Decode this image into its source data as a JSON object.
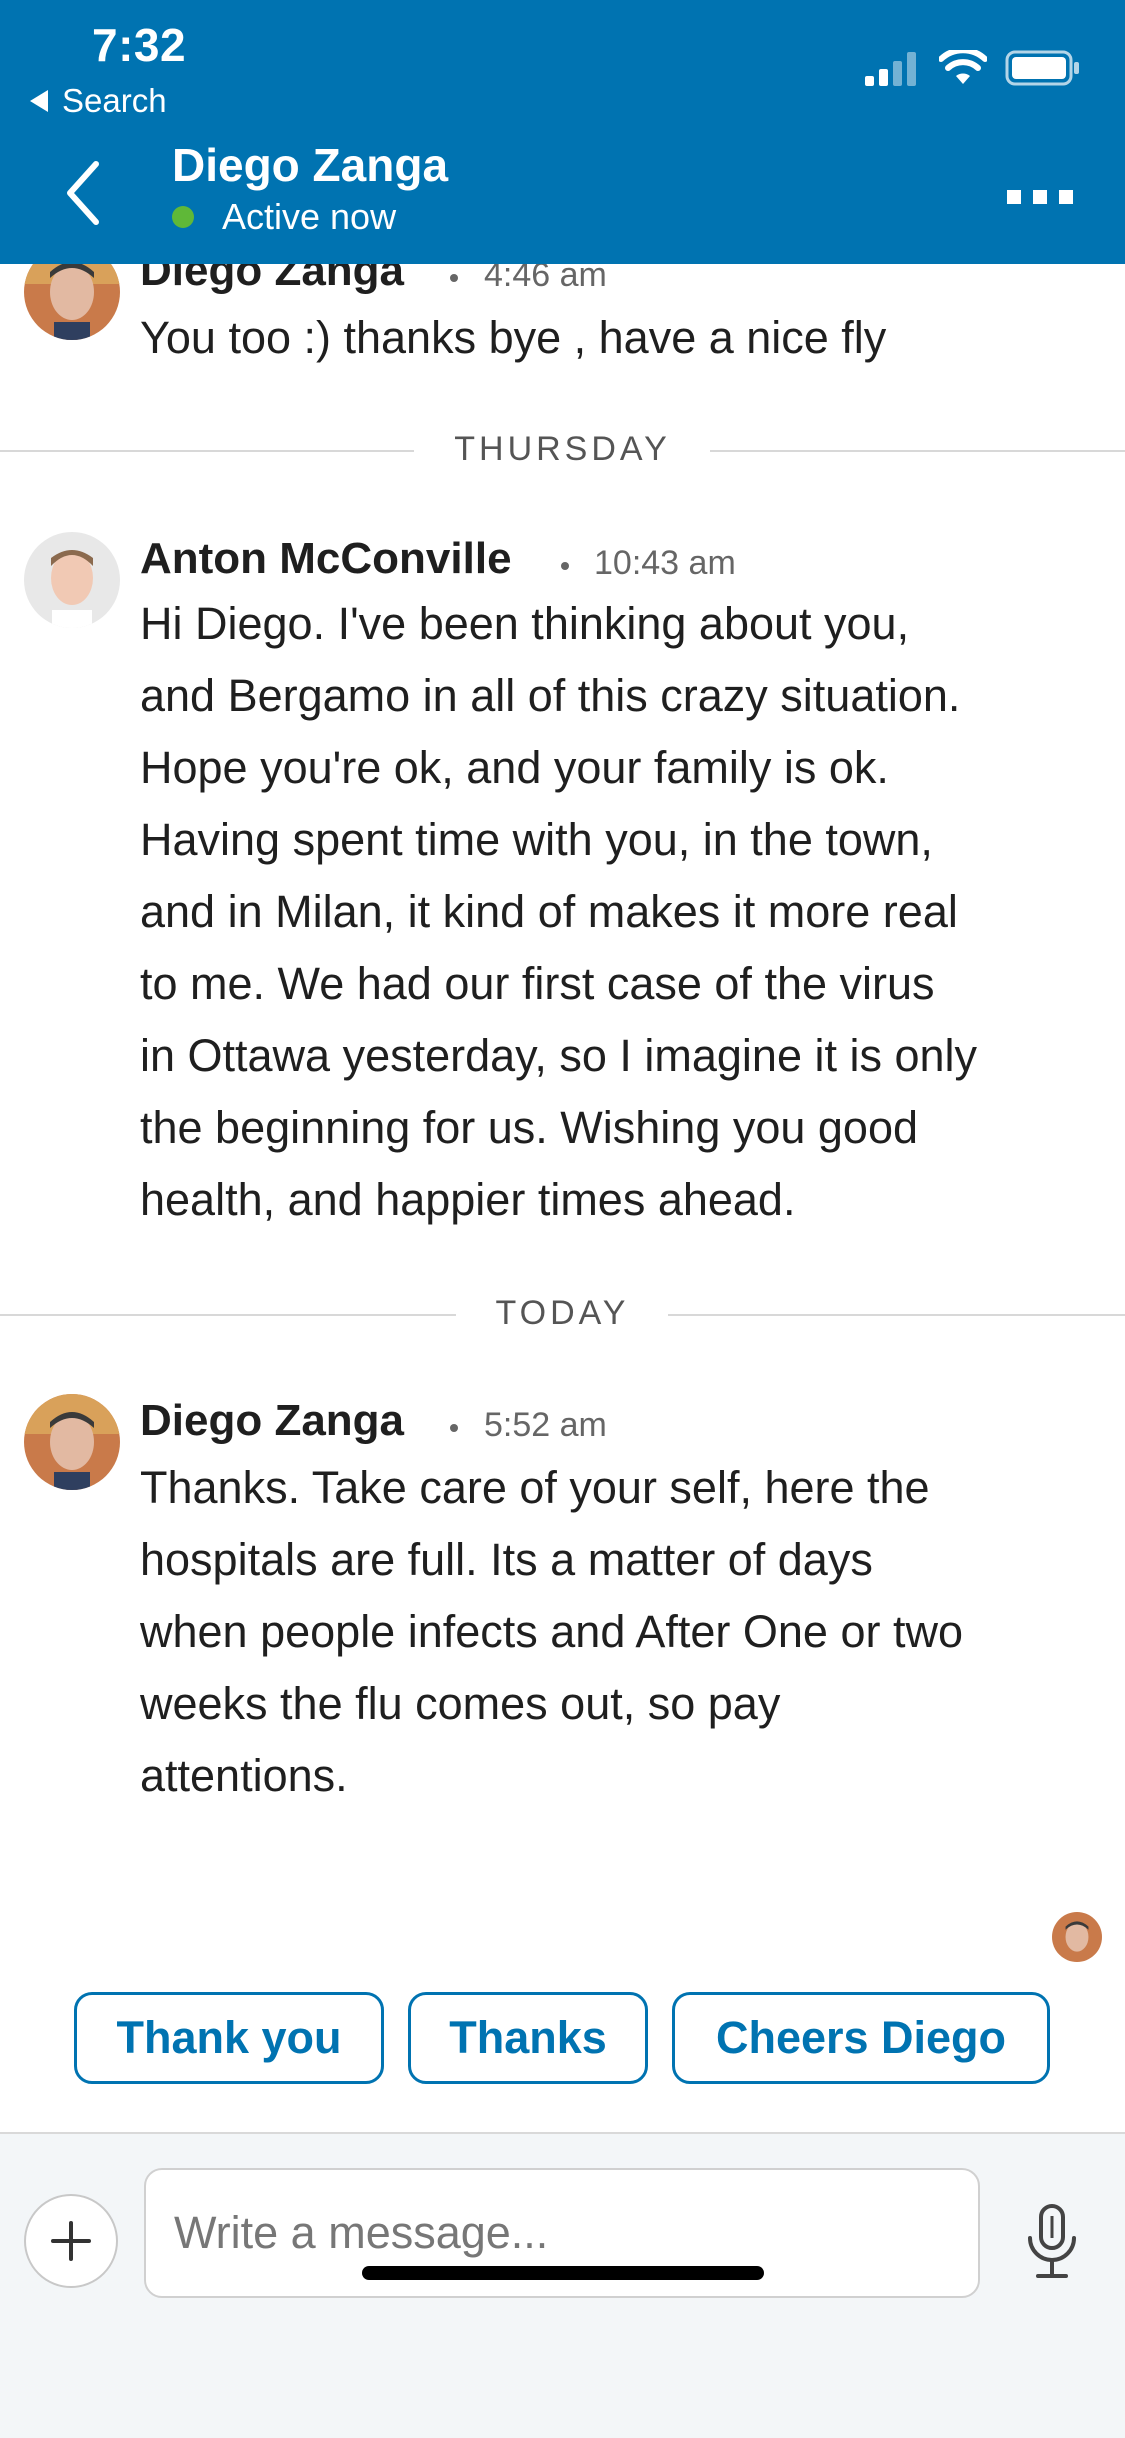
{
  "status_bar": {
    "time": "7:32",
    "back_app_label": "Search"
  },
  "header": {
    "contact_name": "Diego Zanga",
    "presence": "Active now",
    "presence_color": "#5fb838",
    "background_color": "#0073b1"
  },
  "messages": [
    {
      "sender": "Diego Zanga",
      "time": "4:46 am",
      "text": "You too :) thanks bye , have a nice fly"
    },
    {
      "sender": "Anton McConville",
      "time": "10:43 am",
      "lines": [
        "Hi Diego. I've been thinking about you,",
        "and Bergamo in all of this crazy situation.",
        "Hope you're ok, and your family is ok.",
        "Having spent time with you, in the town,",
        "and in Milan, it kind of makes it more real",
        "to me. We had our first case of the virus",
        "in Ottawa yesterday, so I imagine it is only",
        "the beginning for us. Wishing you good",
        "health, and happier times ahead."
      ]
    },
    {
      "sender": "Diego Zanga",
      "time": "5:52 am",
      "lines": [
        "Thanks. Take care of your self, here the",
        "hospitals are full. Its a matter of days",
        "when people infects and After One or two",
        "weeks the flu comes out, so pay",
        "attentions."
      ]
    }
  ],
  "dividers": {
    "thursday": "THURSDAY",
    "today": "TODAY"
  },
  "quick_replies": [
    "Thank you",
    "Thanks",
    "Cheers Diego"
  ],
  "composer": {
    "placeholder": "Write a message..."
  },
  "icons": {
    "back": "chevron-left-icon",
    "more": "more-horizontal-icon",
    "add": "plus-icon",
    "mic": "microphone-icon",
    "signal": "cellular-signal-icon",
    "wifi": "wifi-icon",
    "battery": "battery-icon"
  }
}
